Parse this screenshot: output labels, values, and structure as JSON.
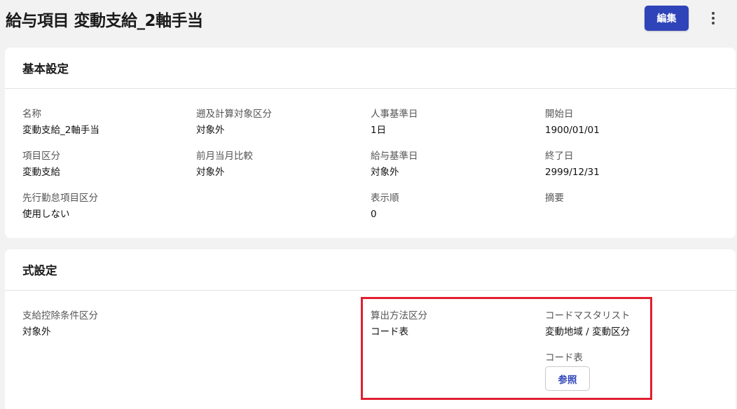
{
  "page": {
    "title": "給与項目 変動支給_2軸手当",
    "edit_label": "編集"
  },
  "basic": {
    "header": "基本設定",
    "fields": {
      "name": {
        "label": "名称",
        "value": "変動支給_2軸手当"
      },
      "retro": {
        "label": "遡及計算対象区分",
        "value": "対象外"
      },
      "hr_base_date": {
        "label": "人事基準日",
        "value": "1日"
      },
      "start_date": {
        "label": "開始日",
        "value": "1900/01/01"
      },
      "item_type": {
        "label": "項目区分",
        "value": "変動支給"
      },
      "prev_month_compare": {
        "label": "前月当月比較",
        "value": "対象外"
      },
      "pay_base_date": {
        "label": "給与基準日",
        "value": "対象外"
      },
      "end_date": {
        "label": "終了日",
        "value": "2999/12/31"
      },
      "advance_attendance": {
        "label": "先行勤怠項目区分",
        "value": "使用しない"
      },
      "display_order": {
        "label": "表示順",
        "value": "0"
      },
      "summary": {
        "label": "摘要",
        "value": ""
      }
    }
  },
  "formula": {
    "header": "式設定",
    "fields": {
      "pay_deduct_condition": {
        "label": "支給控除条件区分",
        "value": "対象外"
      },
      "calc_method": {
        "label": "算出方法区分",
        "value": "コード表"
      },
      "code_master_list": {
        "label": "コードマスタリスト",
        "value": "変動地域 / 変動区分"
      },
      "code_table": {
        "label": "コード表"
      }
    },
    "ref_button_label": "参照"
  },
  "colors": {
    "accent": "#2f44b9",
    "highlight": "#e02030",
    "background": "#f2f2f2"
  },
  "icons": {
    "more": "more-vertical-icon"
  }
}
